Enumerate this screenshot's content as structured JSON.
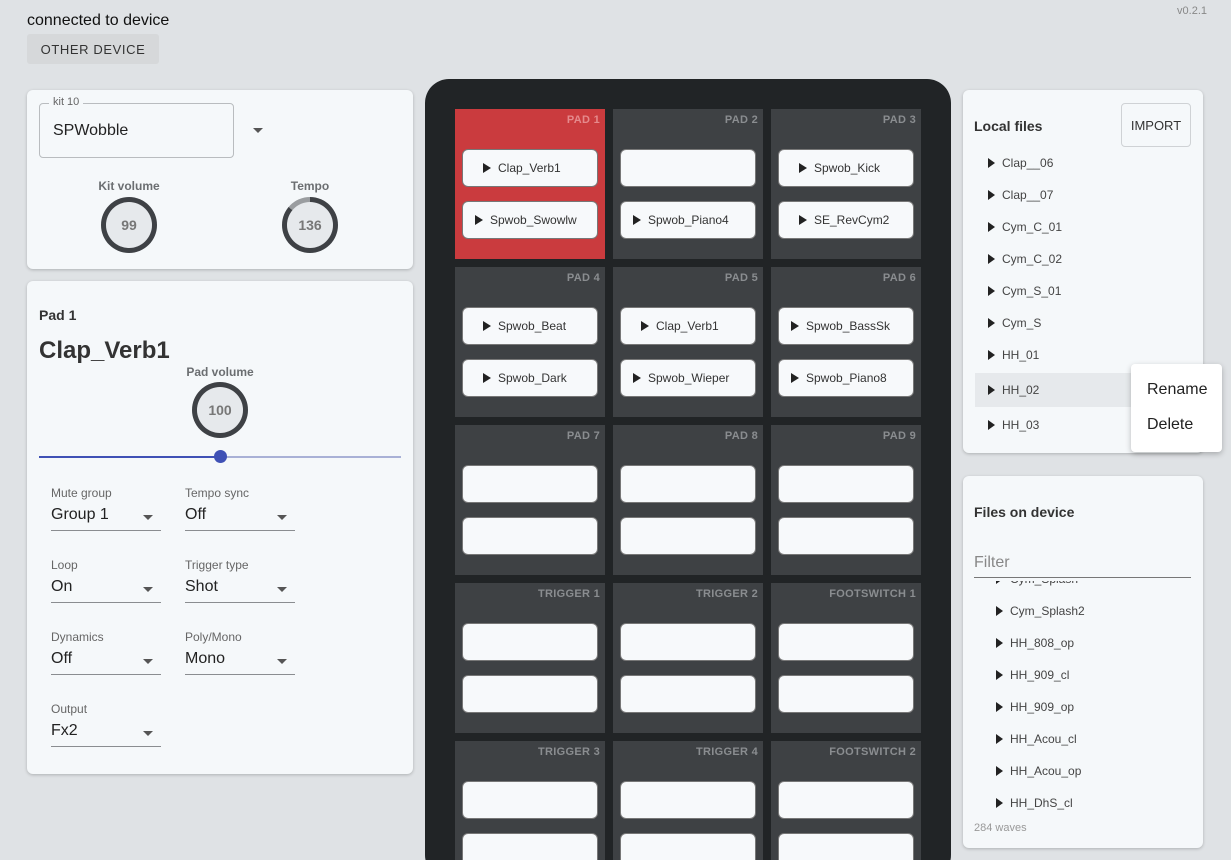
{
  "header": {
    "status": "connected to device",
    "other_device_label": "OTHER DEVICE",
    "version": "v0.2.1"
  },
  "kit": {
    "field_label": "kit 10",
    "name": "SPWobble",
    "kit_volume_label": "Kit volume",
    "kit_volume": "99",
    "tempo_label": "Tempo",
    "tempo": "136"
  },
  "pad_detail": {
    "title": "Pad 1",
    "sample": "Clap_Verb1",
    "pad_volume_label": "Pad volume",
    "pad_volume": "100",
    "slider_fraction": 0.5,
    "mute_group": {
      "label": "Mute group",
      "value": "Group 1"
    },
    "tempo_sync": {
      "label": "Tempo sync",
      "value": "Off"
    },
    "loop": {
      "label": "Loop",
      "value": "On"
    },
    "trigger_type": {
      "label": "Trigger type",
      "value": "Shot"
    },
    "dynamics": {
      "label": "Dynamics",
      "value": "Off"
    },
    "poly_mono": {
      "label": "Poly/Mono",
      "value": "Mono"
    },
    "output": {
      "label": "Output",
      "value": "Fx2"
    }
  },
  "pads": [
    {
      "label": "PAD 1",
      "active": true,
      "a": "Clap_Verb1",
      "b": "Spwob_Swowlw"
    },
    {
      "label": "PAD 2",
      "active": false,
      "a": "",
      "b": "Spwob_Piano4"
    },
    {
      "label": "PAD 3",
      "active": false,
      "a": "Spwob_Kick",
      "b": "SE_RevCym2"
    },
    {
      "label": "PAD 4",
      "active": false,
      "a": "Spwob_Beat",
      "b": "Spwob_Dark"
    },
    {
      "label": "PAD 5",
      "active": false,
      "a": "Clap_Verb1",
      "b": "Spwob_Wieper"
    },
    {
      "label": "PAD 6",
      "active": false,
      "a": "Spwob_BassSk",
      "b": "Spwob_Piano8"
    },
    {
      "label": "PAD 7",
      "active": false,
      "a": "",
      "b": ""
    },
    {
      "label": "PAD 8",
      "active": false,
      "a": "",
      "b": ""
    },
    {
      "label": "PAD 9",
      "active": false,
      "a": "",
      "b": ""
    },
    {
      "label": "TRIGGER 1",
      "active": false,
      "a": "",
      "b": ""
    },
    {
      "label": "TRIGGER 2",
      "active": false,
      "a": "",
      "b": ""
    },
    {
      "label": "FOOTSWITCH 1",
      "active": false,
      "a": "",
      "b": ""
    },
    {
      "label": "TRIGGER 3",
      "active": false,
      "a": "",
      "b": ""
    },
    {
      "label": "TRIGGER 4",
      "active": false,
      "a": "",
      "b": ""
    },
    {
      "label": "FOOTSWITCH 2",
      "active": false,
      "a": "",
      "b": ""
    }
  ],
  "local_files": {
    "title": "Local files",
    "import_label": "IMPORT",
    "items": [
      "Clap__06",
      "Clap__07",
      "Cym_C_01",
      "Cym_C_02",
      "Cym_S_01",
      "Cym_S",
      "HH_01",
      "HH_02",
      "HH_03"
    ],
    "hover_index": 7
  },
  "context_menu": {
    "rename": "Rename",
    "delete": "Delete"
  },
  "device_files": {
    "title": "Files on device",
    "filter_placeholder": "Filter",
    "items": [
      "Cym_Splash",
      "Cym_Splash2",
      "HH_808_op",
      "HH_909_cl",
      "HH_909_op",
      "HH_Acou_cl",
      "HH_Acou_op",
      "HH_DhS_cl"
    ],
    "count_text": "284 waves"
  }
}
